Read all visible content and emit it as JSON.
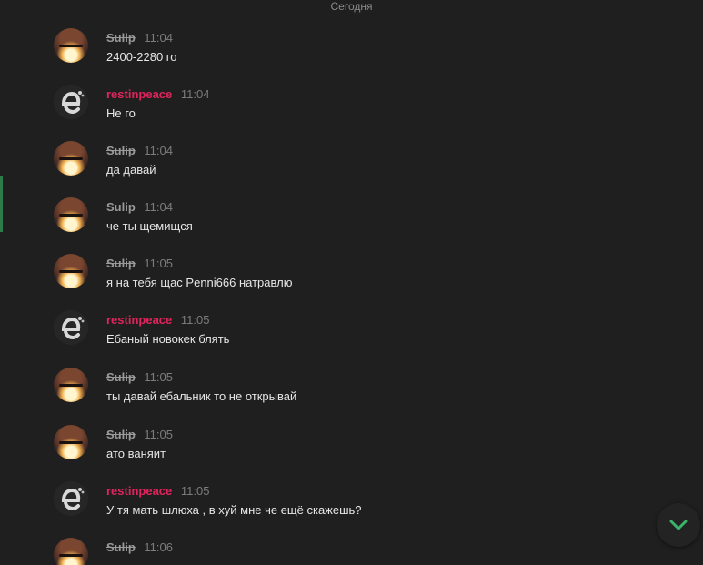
{
  "divider": {
    "date_label": "Сегодня"
  },
  "messages": [
    {
      "author": "Sulip",
      "time": "11:04",
      "text": "2400-2280 го",
      "avatar": "sulip"
    },
    {
      "author": "restinpeace",
      "time": "11:04",
      "text": "Не го",
      "avatar": "rest"
    },
    {
      "author": "Sulip",
      "time": "11:04",
      "text": "да давай",
      "avatar": "sulip"
    },
    {
      "author": "Sulip",
      "time": "11:04",
      "text": "че ты щемищся",
      "avatar": "sulip"
    },
    {
      "author": "Sulip",
      "time": "11:05",
      "text": "я на тебя щас Penni666 натравлю",
      "avatar": "sulip"
    },
    {
      "author": "restinpeace",
      "time": "11:05",
      "text": "Ебаный новокек блять",
      "avatar": "rest"
    },
    {
      "author": "Sulip",
      "time": "11:05",
      "text": "ты давай ебальник то не открывай",
      "avatar": "sulip"
    },
    {
      "author": "Sulip",
      "time": "11:05",
      "text": "ато ваняит",
      "avatar": "sulip"
    },
    {
      "author": "restinpeace",
      "time": "11:05",
      "text": "У тя мать шлюха , в хуй мне че ещё скажешь?",
      "avatar": "rest"
    },
    {
      "author": "Sulip",
      "time": "11:06",
      "text": "",
      "avatar": "sulip"
    }
  ],
  "colors": {
    "background": "#1f1f1f",
    "username_sulip": "#9a9a9a",
    "username_restinpeace": "#e0245e",
    "timestamp": "#7c7c7c",
    "message_text": "#e6e6e6",
    "unread_bar": "#2d7a4a",
    "scroll_button_check": "#3ab56a"
  },
  "scroll_button": {
    "icon": "chevron-down-icon"
  }
}
